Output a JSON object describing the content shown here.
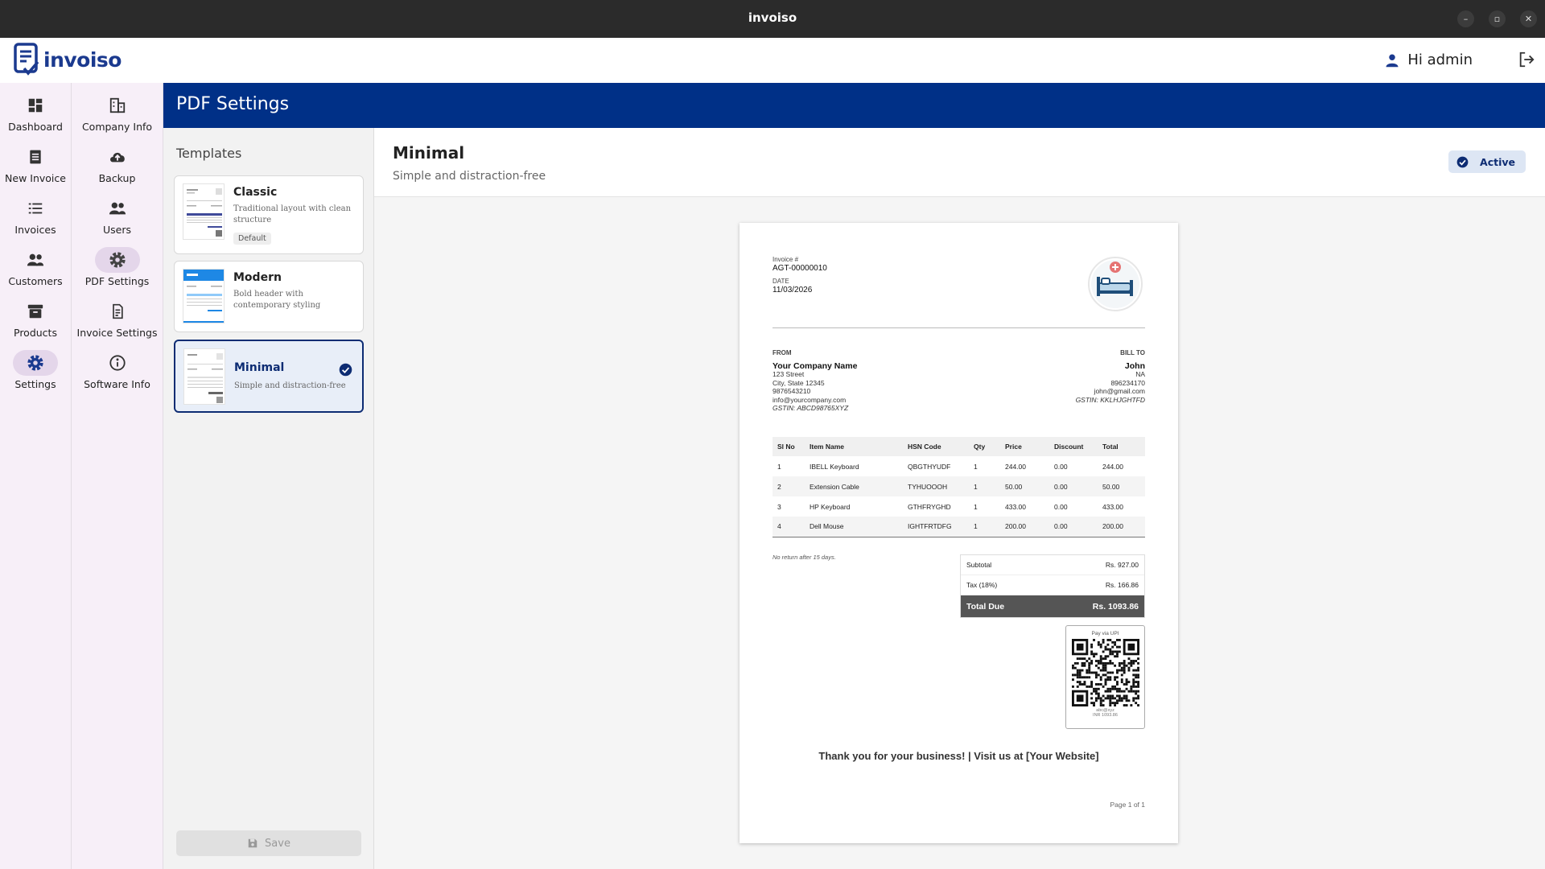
{
  "window": {
    "title": "invoiso",
    "minimize": "–",
    "maximize": "▫",
    "close": "✕"
  },
  "header": {
    "logo_text": "invoiso",
    "greeting": "Hi admin"
  },
  "nav_primary": [
    {
      "label": "Dashboard",
      "icon": "dashboard-icon"
    },
    {
      "label": "New Invoice",
      "icon": "receipt-icon"
    },
    {
      "label": "Invoices",
      "icon": "list-icon"
    },
    {
      "label": "Customers",
      "icon": "people-icon"
    },
    {
      "label": "Products",
      "icon": "archive-icon"
    },
    {
      "label": "Settings",
      "icon": "gear-icon",
      "active": true
    }
  ],
  "nav_secondary": [
    {
      "label": "Company Info",
      "icon": "building-icon"
    },
    {
      "label": "Backup",
      "icon": "cloud-upload-icon"
    },
    {
      "label": "Users",
      "icon": "people-icon"
    },
    {
      "label": "PDF Settings",
      "icon": "gear-icon",
      "active": true
    },
    {
      "label": "Invoice Settings",
      "icon": "document-icon"
    },
    {
      "label": "Software Info",
      "icon": "info-icon"
    }
  ],
  "page": {
    "title": "PDF Settings"
  },
  "templates": {
    "heading": "Templates",
    "items": [
      {
        "name": "Classic",
        "description": "Traditional layout with clean structure",
        "badge": "Default"
      },
      {
        "name": "Modern",
        "description": "Bold header with contemporary styling"
      },
      {
        "name": "Minimal",
        "description": "Simple and distraction-free",
        "selected": true
      }
    ],
    "save_label": "Save"
  },
  "preview": {
    "title": "Minimal",
    "subtitle": "Simple and distraction-free",
    "status": "Active"
  },
  "invoice": {
    "number_label": "Invoice #",
    "number": "AGT-00000010",
    "date_label": "DATE",
    "date": "11/03/2026",
    "from_label": "FROM",
    "from": {
      "name": "Your Company Name",
      "address1": "123 Street",
      "address2": "City, State 12345",
      "phone": "9876543210",
      "email": "info@yourcompany.com",
      "gstin": "GSTIN: ABCD98765XYZ"
    },
    "bill_to_label": "BILL TO",
    "bill_to": {
      "name": "John",
      "address": "NA",
      "phone": "896234170",
      "email": "john@gmail.com",
      "gstin": "GSTIN: KKLHJGHTFD"
    },
    "columns": [
      "Sl No",
      "Item Name",
      "HSN Code",
      "Qty",
      "Price",
      "Discount",
      "Total"
    ],
    "rows": [
      [
        "1",
        "IBELL Keyboard",
        "QBGTHYUDF",
        "1",
        "244.00",
        "0.00",
        "244.00"
      ],
      [
        "2",
        "Extension Cable",
        "TYHUOOOH",
        "1",
        "50.00",
        "0.00",
        "50.00"
      ],
      [
        "3",
        "HP Keyboard",
        "GTHFRYGHD",
        "1",
        "433.00",
        "0.00",
        "433.00"
      ],
      [
        "4",
        "Dell Mouse",
        "IGHTFRTDFG",
        "1",
        "200.00",
        "0.00",
        "200.00"
      ]
    ],
    "note": "No return after 15 days.",
    "subtotal_label": "Subtotal",
    "subtotal": "Rs. 927.00",
    "tax_label": "Tax (18%)",
    "tax": "Rs. 166.86",
    "total_label": "Total Due",
    "total": "Rs. 1093.86",
    "qr_title": "Pay via UPI",
    "qr_upi": "abc@xyz",
    "qr_amount": "INR 1093.86",
    "thanks": "Thank you for your business! | Visit us at [Your Website]",
    "page_number": "Page 1 of 1"
  },
  "colors": {
    "brand": "#003087",
    "accent": "#0d2c73",
    "nav_bg": "#f7eff8"
  }
}
